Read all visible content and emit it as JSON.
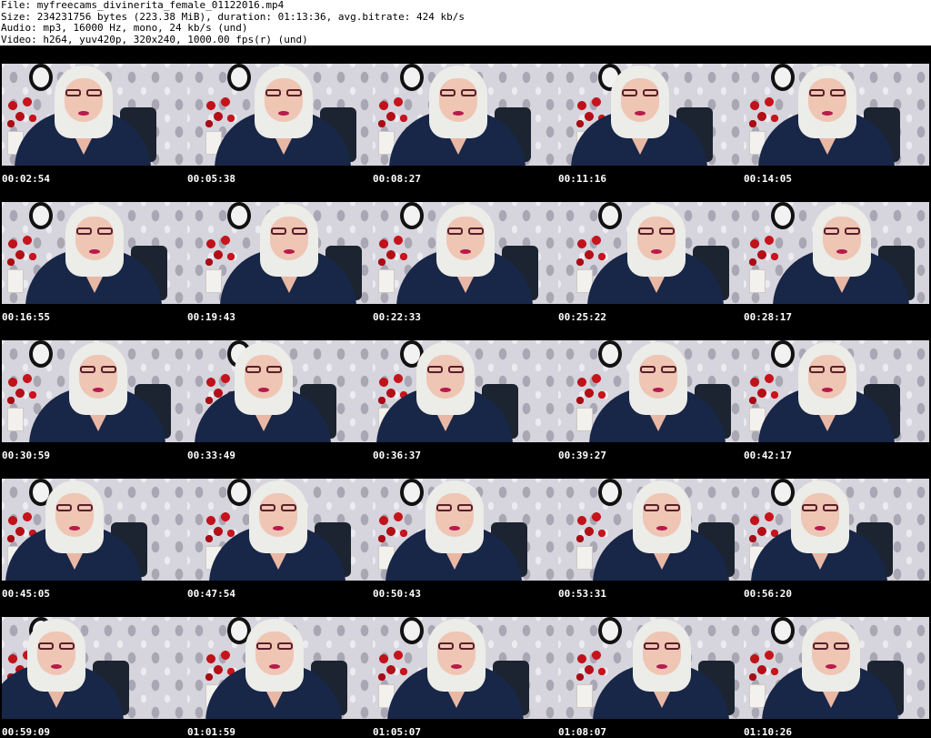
{
  "file_info": {
    "file": "File: myfreecams_divinerita_female_01122016.mp4",
    "size": "Size: 234231756 bytes (223.38 MiB), duration: 01:13:36, avg.bitrate: 424 kb/s",
    "audio": "Audio: mp3, 16000 Hz, mono, 24 kb/s (und)",
    "video": "Video: h264, yuv420p, 320x240, 1000.00 fps(r) (und)"
  },
  "timestamps": [
    "00:02:54",
    "00:05:38",
    "00:08:27",
    "00:11:16",
    "00:14:05",
    "00:16:55",
    "00:19:43",
    "00:22:33",
    "00:25:22",
    "00:28:17",
    "00:30:59",
    "00:33:49",
    "00:36:37",
    "00:39:27",
    "00:42:17",
    "00:45:05",
    "00:47:54",
    "00:50:43",
    "00:53:31",
    "00:56:20",
    "00:59:09",
    "01:01:59",
    "01:05:07",
    "01:08:07",
    "01:10:26"
  ]
}
